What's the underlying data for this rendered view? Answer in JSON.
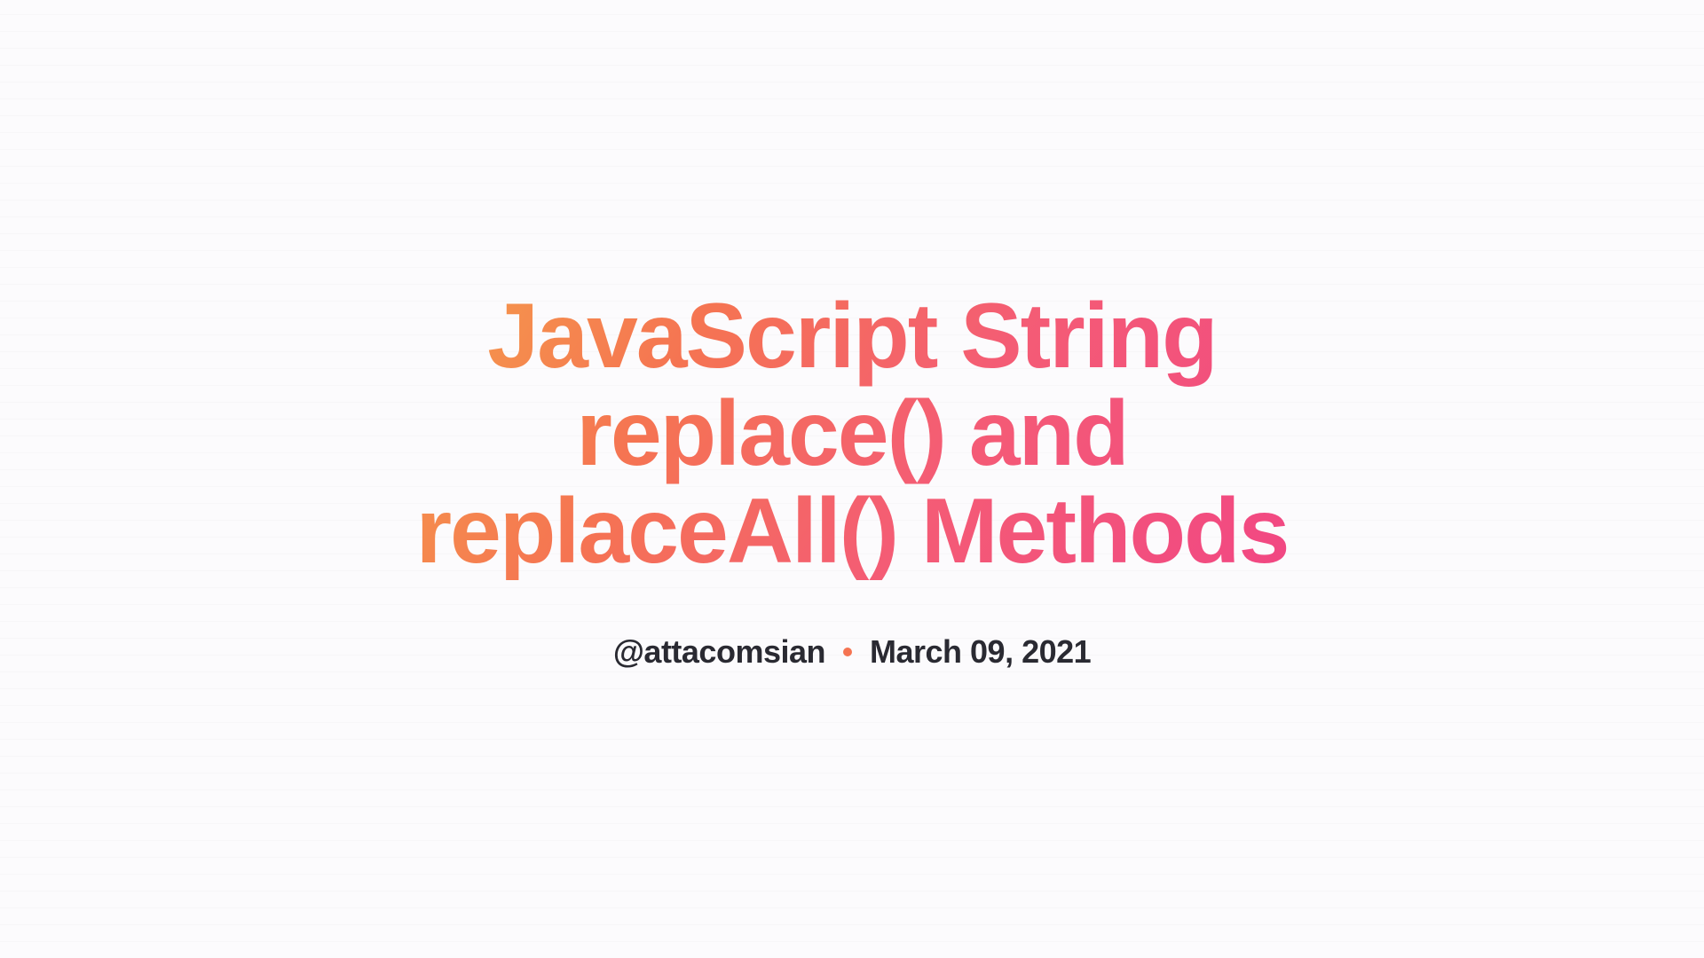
{
  "main": {
    "title": "JavaScript String replace() and replaceAll() Methods",
    "author_handle": "@attacomsian",
    "date": "March 09, 2021"
  }
}
